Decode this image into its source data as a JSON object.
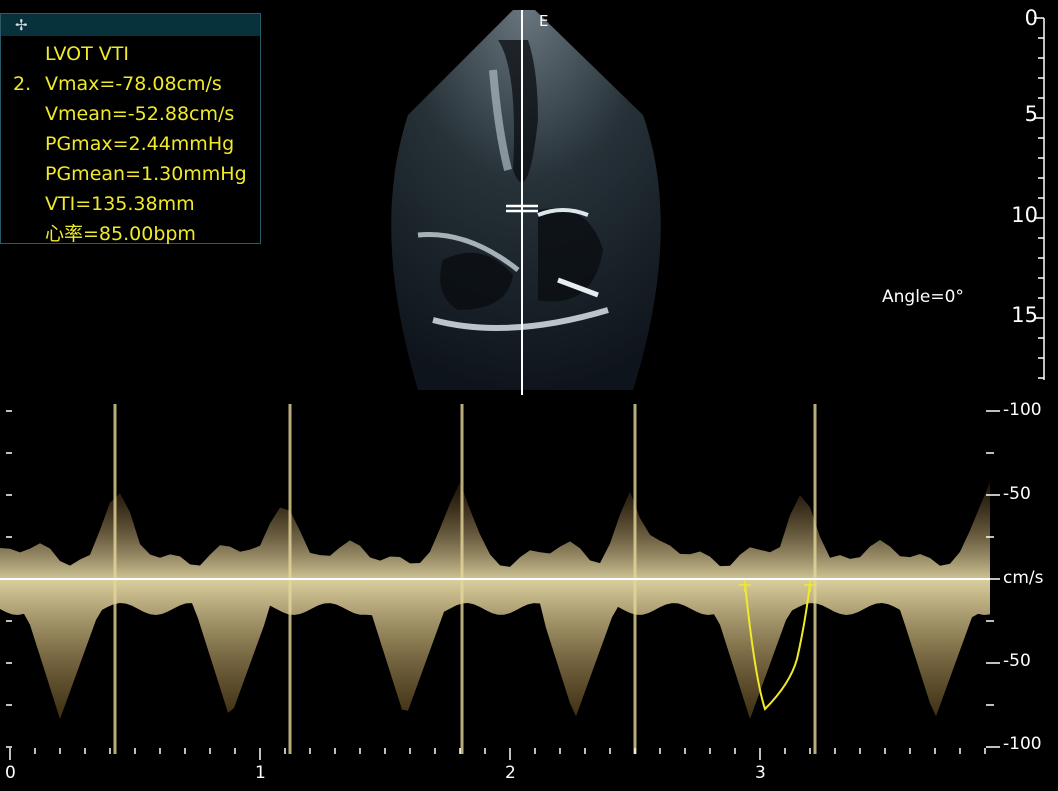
{
  "measurement": {
    "title": "LVOT VTI",
    "index": "2.",
    "lines": [
      "Vmax=-78.08cm/s",
      "Vmean=-52.88cm/s",
      "PGmax=2.44mmHg",
      "PGmean=1.30mmHg",
      "VTI=135.38mm",
      "心率=85.00bpm"
    ],
    "header_icon": "crosshair-icon"
  },
  "image": {
    "marker": "E",
    "angle": "Angle=0°"
  },
  "depth_scale": {
    "labels": [
      "0",
      "5",
      "10",
      "15"
    ]
  },
  "velocity_scale": {
    "labels": [
      "-100",
      "-50",
      "cm/s",
      "-50",
      "-100"
    ]
  },
  "time_scale": {
    "labels": [
      "0",
      "1",
      "2",
      "3"
    ]
  },
  "colors": {
    "accent": "#f0ea2a",
    "doppler": "#e6d79a",
    "panel_border": "#2a5a66"
  }
}
